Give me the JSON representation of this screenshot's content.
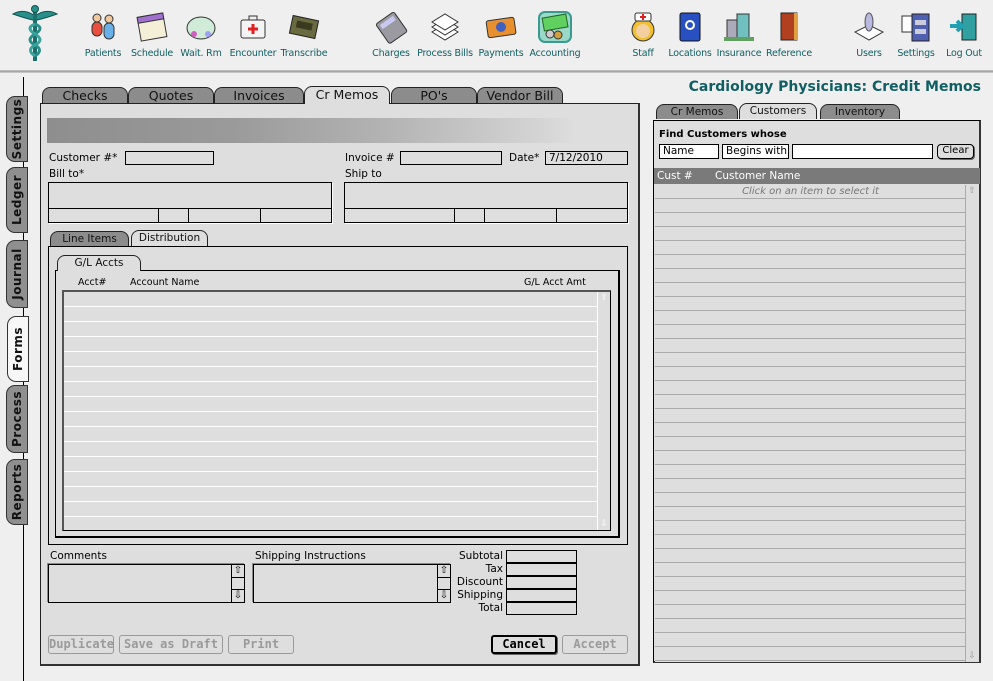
{
  "toolbar": {
    "items": [
      {
        "label": "Patients",
        "icon": "patients-icon"
      },
      {
        "label": "Schedule",
        "icon": "calendar-icon"
      },
      {
        "label": "Wait. Rm",
        "icon": "waiting-room-icon"
      },
      {
        "label": "Encounter",
        "icon": "medical-kit-icon"
      },
      {
        "label": "Transcribe",
        "icon": "cassette-icon"
      },
      {
        "label": "Charges",
        "icon": "calculator-icon"
      },
      {
        "label": "Process Bills",
        "icon": "paper-stack-icon"
      },
      {
        "label": "Payments",
        "icon": "credit-card-icon"
      },
      {
        "label": "Accounting",
        "icon": "money-icon"
      },
      {
        "label": "Staff",
        "icon": "nurse-icon"
      },
      {
        "label": "Locations",
        "icon": "address-book-icon"
      },
      {
        "label": "Insurance",
        "icon": "buildings-icon"
      },
      {
        "label": "Reference",
        "icon": "book-icon"
      },
      {
        "label": "Users",
        "icon": "user-icon"
      },
      {
        "label": "Settings",
        "icon": "cabinet-icon"
      },
      {
        "label": "Log Out",
        "icon": "exit-door-icon"
      }
    ]
  },
  "side_tabs": [
    {
      "label": "Settings",
      "active": false
    },
    {
      "label": "Ledger",
      "active": false
    },
    {
      "label": "Journal",
      "active": false
    },
    {
      "label": "Forms",
      "active": true
    },
    {
      "label": "Process",
      "active": false
    },
    {
      "label": "Reports",
      "active": false
    }
  ],
  "form_tabs": [
    {
      "label": "Checks",
      "active": false
    },
    {
      "label": "Quotes",
      "active": false
    },
    {
      "label": "Invoices",
      "active": false
    },
    {
      "label": "Cr Memos",
      "active": true
    },
    {
      "label": "PO's",
      "active": false
    },
    {
      "label": "Vendor Bill",
      "active": false
    }
  ],
  "form": {
    "customer_label": "Customer #*",
    "customer_value": "",
    "invoice_label": "Invoice #",
    "invoice_value": "",
    "date_label": "Date*",
    "date_value": "7/12/2010",
    "bill_to_label": "Bill to*",
    "ship_to_label": "Ship to",
    "sub_tabs": [
      {
        "label": "Line Items",
        "active": false
      },
      {
        "label": "Distribution",
        "active": true
      }
    ],
    "gl_tab": "G/L Accts",
    "gl_columns": [
      "Acct#",
      "Account Name",
      "G/L Acct Amt"
    ],
    "gl_rows": 15,
    "comments_label": "Comments",
    "shipping_label": "Shipping Instructions",
    "totals": [
      {
        "label": "Subtotal",
        "value": ""
      },
      {
        "label": "Tax",
        "value": ""
      },
      {
        "label": "Discount",
        "value": ""
      },
      {
        "label": "Shipping",
        "value": ""
      },
      {
        "label": "Total",
        "value": ""
      }
    ],
    "buttons": {
      "duplicate": "Duplicate",
      "save_draft": "Save as Draft",
      "print": "Print",
      "cancel": "Cancel",
      "accept": "Accept"
    }
  },
  "header": {
    "title": "Cardiology Physicians:  Credit Memos"
  },
  "right_panel": {
    "tabs": [
      {
        "label": "Cr Memos",
        "active": false
      },
      {
        "label": "Customers",
        "active": true
      },
      {
        "label": "Inventory",
        "active": false
      }
    ],
    "find_label": "Find Customers whose",
    "field_select": "Name",
    "op_select": "Begins with",
    "search_value": "",
    "clear_label": "Clear",
    "columns": [
      "Cust #",
      "Customer Name"
    ],
    "placeholder_row": "Click on an item to select it",
    "rows": 34
  },
  "colors": {
    "accent": "#115f63",
    "panel": "#dedede",
    "header_bar": "#7a7a7a"
  }
}
